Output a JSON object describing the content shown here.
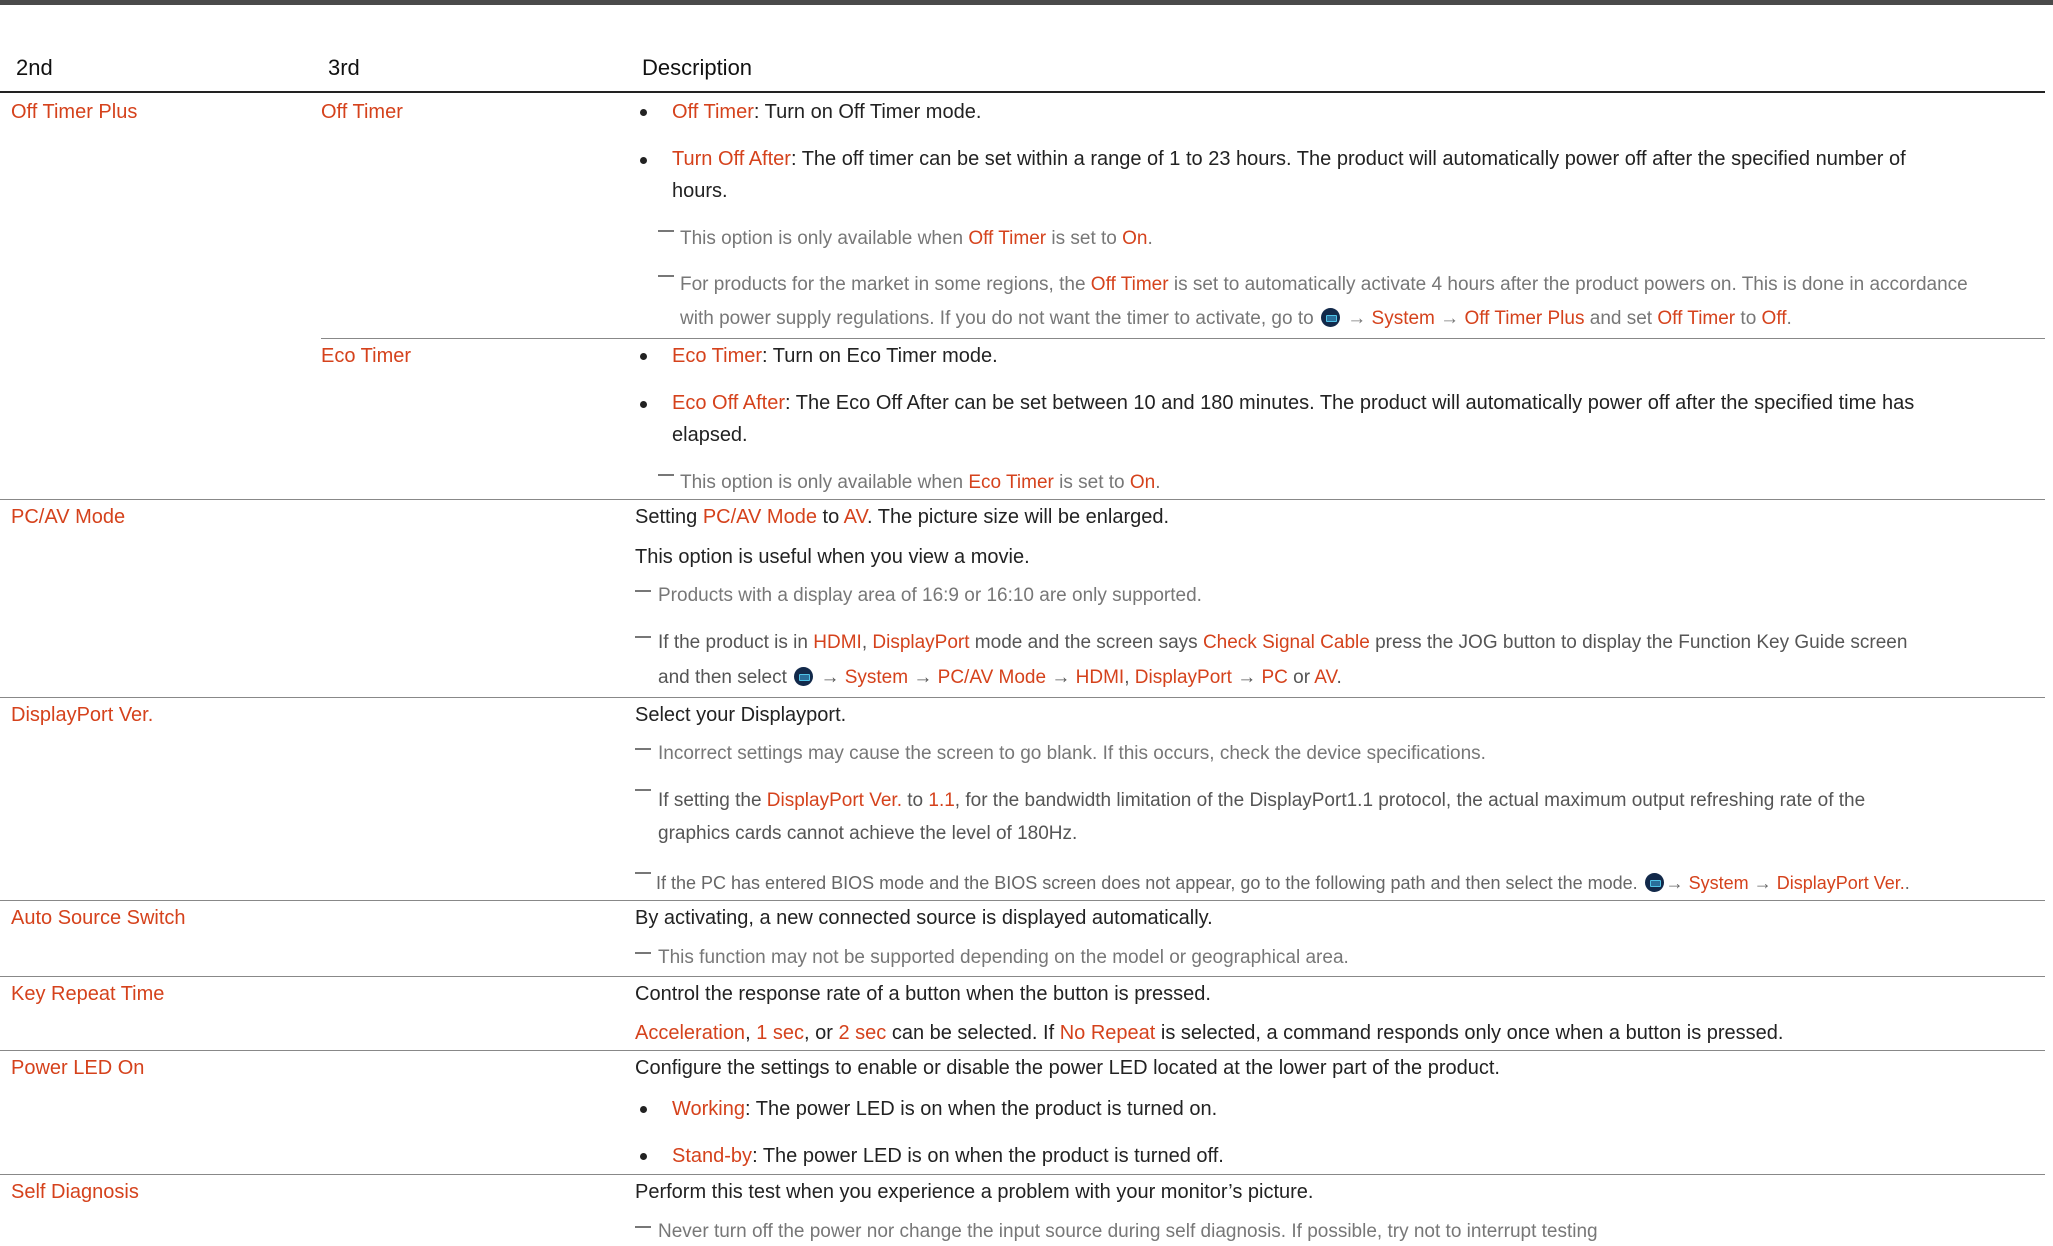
{
  "headers": {
    "col_2nd": "2nd",
    "col_3rd": "3rd",
    "col_desc": "Description"
  },
  "arrow": "→",
  "off_timer_plus": {
    "label": "Off Timer Plus",
    "off_timer": {
      "label": "Off Timer",
      "b1_term": "Off Timer",
      "b1_text": ": Turn on Off Timer mode.",
      "b2_term": "Turn Off After",
      "b2_text_l1": ": The off timer can be set within a range of 1 to 23 hours. The product will automatically power off after the specified number of",
      "b2_text_l2": "hours.",
      "n1_pre": "This option is only available when ",
      "n1_term": "Off Timer",
      "n1_mid": " is set to ",
      "n1_val": "On",
      "n1_end": ".",
      "n2_l1_pre": "For products for the market in some regions, the ",
      "n2_l1_term": "Off Timer",
      "n2_l1_post": " is set to automatically activate 4 hours after the product powers on. This is done in accordance",
      "n2_l2_pre": "with power supply regulations. If you do not want the timer to activate, go to ",
      "n2_l2_system": "System",
      "n2_l2_otp": "Off Timer Plus",
      "n2_l2_and": " and set ",
      "n2_l2_term": "Off Timer",
      "n2_l2_to": " to ",
      "n2_l2_val": "Off",
      "n2_l2_end": "."
    },
    "eco_timer": {
      "label": "Eco Timer",
      "b1_term": "Eco Timer",
      "b1_text": ": Turn on Eco Timer mode.",
      "b2_term": "Eco Off After",
      "b2_text_l1": ": The Eco Off After can be set between 10 and 180 minutes. The product will automatically power off after the specified time has",
      "b2_text_l2": "elapsed.",
      "n1_pre": "This option is only available when ",
      "n1_term": "Eco Timer",
      "n1_mid": " is set to ",
      "n1_val": "On",
      "n1_end": "."
    }
  },
  "pcav": {
    "label": "PC/AV Mode",
    "l1_pre": "Setting ",
    "l1_term": "PC/AV Mode",
    "l1_mid": " to ",
    "l1_val": "AV",
    "l1_post": ". The picture size will be enlarged.",
    "l2": "This option is useful when you view a movie.",
    "n1": "Products with a display area of 16:9 or 16:10 are only supported.",
    "n2_l1_pre": "If the product is in ",
    "n2_l1_hdmi": "HDMI",
    "n2_l1_comma": ", ",
    "n2_l1_dp": "DisplayPort",
    "n2_l1_mid": " mode and the screen says ",
    "n2_l1_csc": "Check Signal Cable",
    "n2_l1_post": " press the JOG button to display the Function Key Guide screen",
    "n2_l2_pre": "and then select ",
    "n2_l2_system": "System",
    "n2_l2_pcav": "PC/AV Mode",
    "n2_l2_hdmi": "HDMI",
    "n2_l2_comma": ", ",
    "n2_l2_dp": "DisplayPort",
    "n2_l2_pc": "PC",
    "n2_l2_or": " or ",
    "n2_l2_av": "AV",
    "n2_l2_end": "."
  },
  "dpver": {
    "label": "DisplayPort Ver.",
    "l1": "Select your Displayport.",
    "n1": "Incorrect settings may cause the screen to go blank. If this occurs, check the device specifications.",
    "n2_l1_pre": "If setting the ",
    "n2_l1_term": "DisplayPort Ver.",
    "n2_l1_to": " to ",
    "n2_l1_val": "1.1",
    "n2_l1_post": ", for the bandwidth limitation of the DisplayPort1.1 protocol, the actual maximum output refreshing rate of the",
    "n2_l2": "graphics cards cannot achieve the level of 180Hz.",
    "n3_pre": "If the PC has entered BIOS mode and the BIOS screen does not appear, go to the following path and then select the mode. ",
    "n3_system": "System",
    "n3_dp": "DisplayPort Ver.",
    "n3_end": "."
  },
  "auto_source": {
    "label": "Auto Source Switch",
    "l1": "By activating, a new connected source is displayed automatically.",
    "n1": "This function may not be supported depending on the model or geographical area."
  },
  "key_repeat": {
    "label": "Key Repeat Time",
    "l1": "Control the response rate of a button when the button is pressed.",
    "l2_acc": "Acceleration",
    "l2_c1": ", ",
    "l2_1sec": "1 sec",
    "l2_c2": ", or ",
    "l2_2sec": "2 sec",
    "l2_mid": " can be selected. If ",
    "l2_norep": "No Repeat",
    "l2_post": " is selected, a command responds only once when a button is pressed."
  },
  "power_led": {
    "label": "Power LED On",
    "l1": "Configure the settings to enable or disable the power LED located at the lower part of the product.",
    "b1_term": "Working",
    "b1_text": ": The power LED is on when the product is turned on.",
    "b2_term": "Stand-by",
    "b2_text": ": The power LED is on when the product is turned off."
  },
  "self_diag": {
    "label": "Self Diagnosis",
    "l1": "Perform this test when you experience a problem with your monitor’s picture.",
    "n1": "Never turn off the power nor change the input source during self diagnosis. If possible, try not to interrupt testing"
  }
}
